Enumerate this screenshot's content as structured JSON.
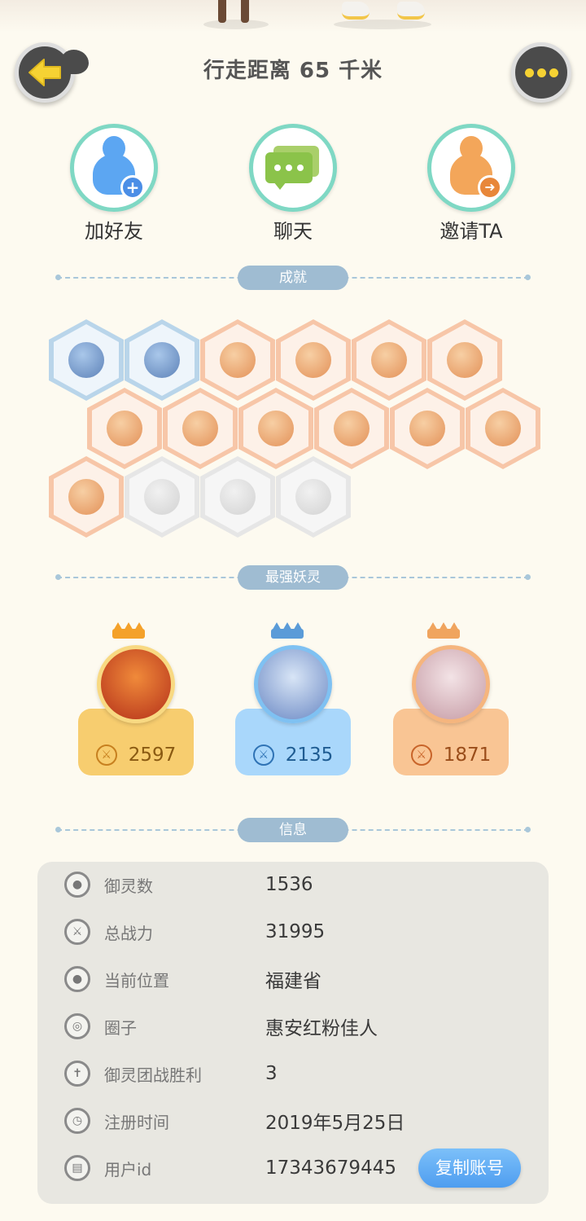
{
  "header": {
    "title": "行走距离 65 千米",
    "back_icon": "arrow-left-icon",
    "more_icon": "more-dots-icon"
  },
  "actions": [
    {
      "label": "加好友",
      "icon": "add-friend-icon"
    },
    {
      "label": "聊天",
      "icon": "chat-icon"
    },
    {
      "label": "邀请TA",
      "icon": "invite-icon"
    }
  ],
  "sections": {
    "achievements": "成就",
    "strongest": "最强妖灵",
    "info": "信息"
  },
  "achievements": [
    {
      "color": "blue"
    },
    {
      "color": "blue"
    },
    {
      "color": "orange"
    },
    {
      "color": "orange"
    },
    {
      "color": "orange"
    },
    {
      "color": "orange"
    },
    {
      "color": "orange"
    },
    {
      "color": "orange"
    },
    {
      "color": "orange"
    },
    {
      "color": "orange"
    },
    {
      "color": "orange"
    },
    {
      "color": "orange"
    },
    {
      "color": "orange"
    },
    {
      "color": "gray"
    },
    {
      "color": "gray"
    },
    {
      "color": "gray"
    }
  ],
  "spirits": [
    {
      "power": "2597",
      "accent": "#f7cd6f"
    },
    {
      "power": "2135",
      "accent": "#a9d7fb"
    },
    {
      "power": "1871",
      "accent": "#f9c594"
    }
  ],
  "info": [
    {
      "label": "御灵数",
      "value": "1536",
      "icon": "spirit-count-icon"
    },
    {
      "label": "总战力",
      "value": "31995",
      "icon": "sword-icon"
    },
    {
      "label": "当前位置",
      "value": "福建省",
      "icon": "location-pin-icon"
    },
    {
      "label": "圈子",
      "value": "惠安红粉佳人",
      "icon": "circle-icon"
    },
    {
      "label": "御灵团战胜利",
      "value": "3",
      "icon": "trophy-icon"
    },
    {
      "label": "注册时间",
      "value": "2019年5月25日",
      "icon": "clock-icon"
    },
    {
      "label": "用户id",
      "value": "17343679445",
      "icon": "id-card-icon"
    }
  ],
  "copy_button": "复制账号"
}
